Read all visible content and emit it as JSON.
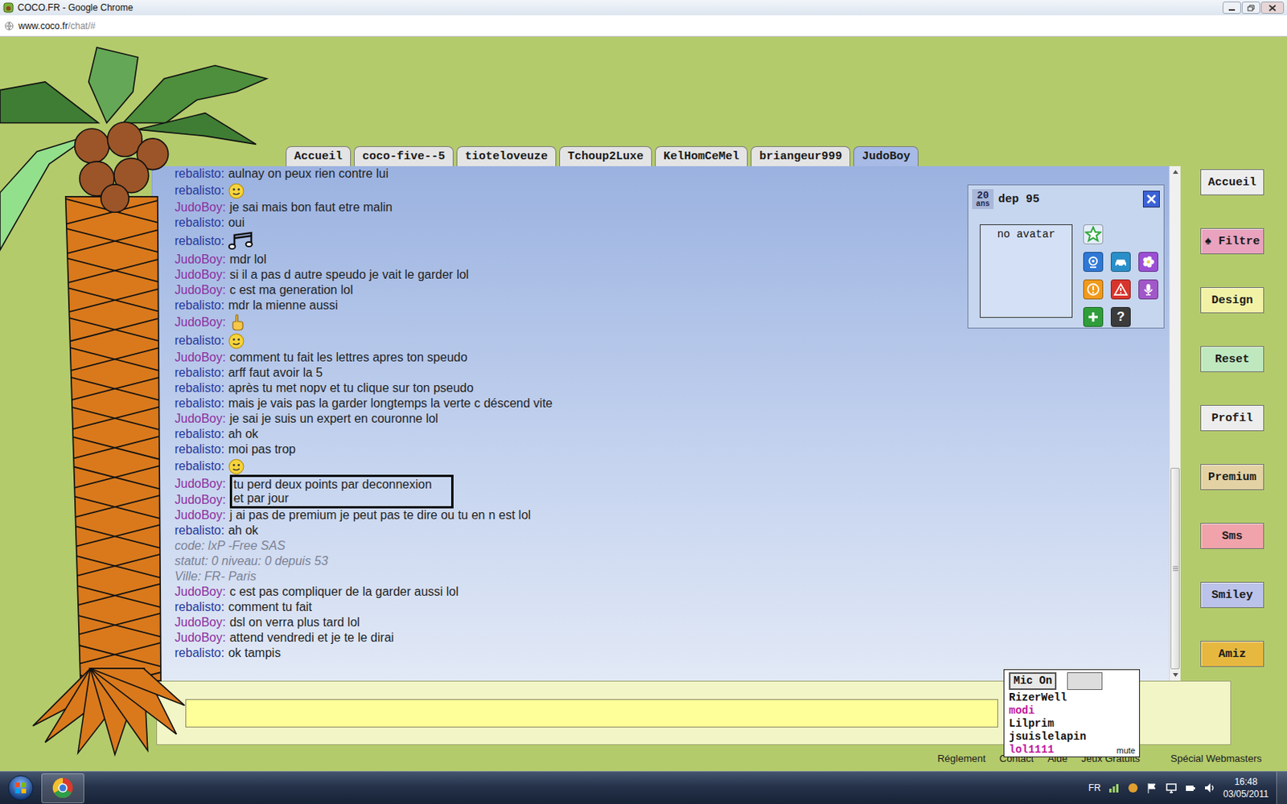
{
  "window": {
    "title": "COCO.FR - Google Chrome"
  },
  "address": {
    "host": "www.coco.fr",
    "path": "/chat/#"
  },
  "tabs": [
    {
      "label": "Accueil",
      "selected": false
    },
    {
      "label": "coco-five--5",
      "selected": false
    },
    {
      "label": "tioteloveuze",
      "selected": false
    },
    {
      "label": "Tchoup2Luxe",
      "selected": false
    },
    {
      "label": "KelHomCeMel",
      "selected": false
    },
    {
      "label": "briangeur999",
      "selected": false
    },
    {
      "label": "JudoBoy",
      "selected": true
    }
  ],
  "messages": [
    {
      "kind": "text",
      "user": "rebalisto:",
      "color": "#27379a",
      "text": "aulnay on peux rien contre lui",
      "highlighted": false
    },
    {
      "kind": "smiley",
      "user": "rebalisto:",
      "color": "#27379a",
      "highlighted": false
    },
    {
      "kind": "text",
      "user": "JudoBoy:",
      "color": "#8b2f9f",
      "text": "je sai mais bon faut etre malin",
      "highlighted": false
    },
    {
      "kind": "text",
      "user": "rebalisto:",
      "color": "#27379a",
      "text": "oui",
      "highlighted": false
    },
    {
      "kind": "notes",
      "user": "rebalisto:",
      "color": "#27379a",
      "highlighted": false
    },
    {
      "kind": "text",
      "user": "JudoBoy:",
      "color": "#8b2f9f",
      "text": "mdr lol",
      "highlighted": false
    },
    {
      "kind": "text",
      "user": "JudoBoy:",
      "color": "#8b2f9f",
      "text": "si il a pas d autre speudo je vait le garder lol",
      "highlighted": false
    },
    {
      "kind": "text",
      "user": "JudoBoy:",
      "color": "#8b2f9f",
      "text": "c est ma generation lol",
      "highlighted": false
    },
    {
      "kind": "text",
      "user": "rebalisto:",
      "color": "#27379a",
      "text": "mdr la mienne aussi",
      "highlighted": false
    },
    {
      "kind": "hand",
      "user": "JudoBoy:",
      "color": "#8b2f9f",
      "highlighted": false
    },
    {
      "kind": "smiley",
      "user": "rebalisto:",
      "color": "#27379a",
      "highlighted": false
    },
    {
      "kind": "text",
      "user": "JudoBoy:",
      "color": "#8b2f9f",
      "text": "comment tu fait les lettres apres ton speudo",
      "highlighted": false
    },
    {
      "kind": "text",
      "user": "rebalisto:",
      "color": "#27379a",
      "text": "arff faut avoir la 5",
      "highlighted": false
    },
    {
      "kind": "text",
      "user": "rebalisto:",
      "color": "#27379a",
      "text": "après tu met nopv et tu clique sur ton pseudo",
      "highlighted": false
    },
    {
      "kind": "text",
      "user": "rebalisto:",
      "color": "#27379a",
      "text": "mais je vais pas la garder longtemps la verte c déscend vite",
      "highlighted": false
    },
    {
      "kind": "text",
      "user": "JudoBoy:",
      "color": "#8b2f9f",
      "text": "je sai je suis un expert en couronne lol",
      "highlighted": false
    },
    {
      "kind": "text",
      "user": "rebalisto:",
      "color": "#27379a",
      "text": "ah ok",
      "highlighted": false
    },
    {
      "kind": "text",
      "user": "rebalisto:",
      "color": "#27379a",
      "text": "moi pas trop",
      "highlighted": false
    },
    {
      "kind": "smiley",
      "user": "rebalisto:",
      "color": "#27379a",
      "highlighted": false
    },
    {
      "kind": "text",
      "user": "JudoBoy:",
      "color": "#8b2f9f",
      "text": "tu perd deux points par deconnexion",
      "highlighted": true
    },
    {
      "kind": "text",
      "user": "JudoBoy:",
      "color": "#8b2f9f",
      "text": "et par jour",
      "highlighted": true
    },
    {
      "kind": "text",
      "user": "JudoBoy:",
      "color": "#8b2f9f",
      "text": "j ai pas de premium je peut pas te dire ou tu en n est lol",
      "highlighted": false
    },
    {
      "kind": "text",
      "user": "rebalisto:",
      "color": "#27379a",
      "text": "ah ok",
      "highlighted": false
    },
    {
      "kind": "info",
      "text": "code: lxP -Free SAS",
      "highlighted": false
    },
    {
      "kind": "info",
      "text": "statut: 0 niveau: 0 depuis 53",
      "highlighted": false
    },
    {
      "kind": "info",
      "text": "Ville: FR- Paris",
      "highlighted": false
    },
    {
      "kind": "text",
      "user": "JudoBoy:",
      "color": "#8b2f9f",
      "text": "c est pas compliquer de la garder aussi lol",
      "highlighted": false
    },
    {
      "kind": "text",
      "user": "rebalisto:",
      "color": "#27379a",
      "text": "comment tu fait",
      "highlighted": false
    },
    {
      "kind": "text",
      "user": "JudoBoy:",
      "color": "#8b2f9f",
      "text": "dsl on verra plus tard lol",
      "highlighted": false
    },
    {
      "kind": "text",
      "user": "JudoBoy:",
      "color": "#8b2f9f",
      "text": "attend vendredi et je te le dirai",
      "highlighted": false
    },
    {
      "kind": "text",
      "user": "rebalisto:",
      "color": "#27379a",
      "text": "ok tampis",
      "highlighted": false
    }
  ],
  "scrollbar": {
    "level": 1,
    "thumb": 0.41
  },
  "profile": {
    "age": "20",
    "age_unit": "ans",
    "dep": "dep 95",
    "avatar": "no avatar",
    "help": "?"
  },
  "sidebar": [
    {
      "label": "Accueil",
      "color": "#ededed"
    },
    {
      "label": "♠ Filtre",
      "color": "#e9a3bf"
    },
    {
      "label": "Design",
      "color": "#f2f2a6"
    },
    {
      "label": "Reset",
      "color": "#bfe8bf"
    },
    {
      "label": "Profil",
      "color": "#ededed"
    },
    {
      "label": "Premium",
      "color": "#e3d2a4"
    },
    {
      "label": "Sms",
      "color": "#f0a3ab"
    },
    {
      "label": "Smiley",
      "color": "#bcc3ea"
    },
    {
      "label": "Amiz",
      "color": "#e7b840"
    }
  ],
  "input": {
    "value": ""
  },
  "userlist": {
    "mic": "Mic On",
    "users": [
      {
        "name": "RizerWell",
        "color": "#111111"
      },
      {
        "name": "modi",
        "color": "#c0189c"
      },
      {
        "name": "Lilprim",
        "color": "#111111"
      },
      {
        "name": "jsuislelapin",
        "color": "#111111"
      },
      {
        "name": "lol1111",
        "color": "#c0189c"
      }
    ],
    "mute": "mute"
  },
  "footer": [
    "Réglement",
    "Contact",
    "Aide",
    "Jeux Gratuits",
    "Spécial Webmasters"
  ],
  "taskbar": {
    "lang": "FR",
    "time": "16:48",
    "date": "03/05/2011"
  }
}
